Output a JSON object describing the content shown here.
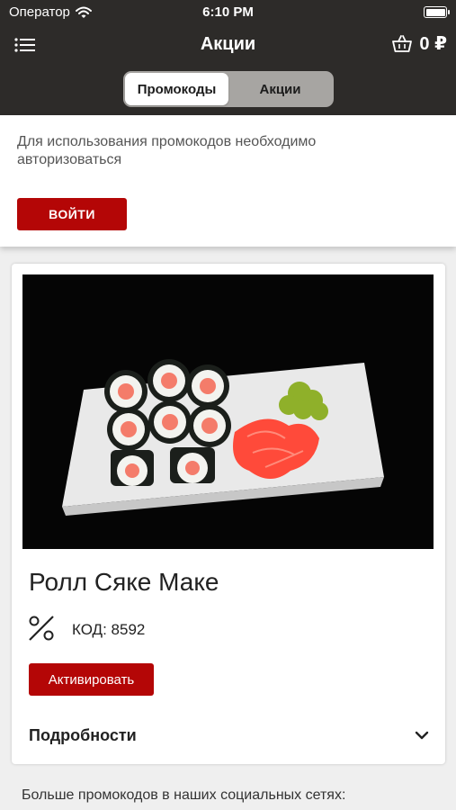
{
  "status_bar": {
    "carrier": "Оператор",
    "time": "6:10 PM"
  },
  "header": {
    "title": "Акции",
    "cart_total": "0 ₽"
  },
  "segments": {
    "items": [
      "Промокоды",
      "Акции"
    ],
    "active": 0
  },
  "auth": {
    "message": "Для использования промокодов необходимо авторизоваться",
    "login_label": "ВОЙТИ"
  },
  "promo": {
    "name": "Ролл Сяке Маке",
    "code_label": "КОД:",
    "code_value": "8592",
    "activate_label": "Активировать",
    "details_label": "Подробности"
  },
  "footer": {
    "social_text": "Больше промокодов в наших социальных сетях:"
  },
  "colors": {
    "accent": "#b40606",
    "header_bg": "#2d2b29"
  },
  "icons": [
    "wifi-icon",
    "battery-icon",
    "menu-icon",
    "basket-icon",
    "percent-icon",
    "chevron-down-icon"
  ]
}
